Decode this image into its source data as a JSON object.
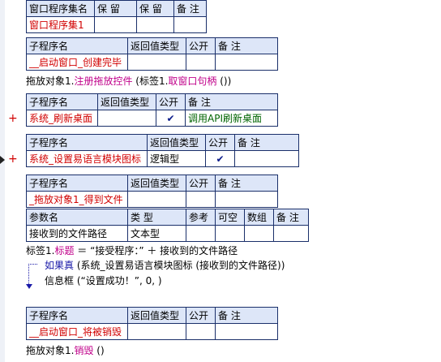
{
  "tbl_set": {
    "headers": [
      "窗口程序集名",
      "保 留",
      "保 留",
      "备 注"
    ],
    "row": [
      "窗口程序集1",
      "",
      "",
      ""
    ]
  },
  "sub_headers": [
    "子程序名",
    "返回值类型",
    "公开",
    "备 注"
  ],
  "param_headers": [
    "参数名",
    "类 型",
    "参考",
    "可空",
    "数组",
    "备 注"
  ],
  "sub1": {
    "name": "__启动窗口_创建完毕",
    "ret": "",
    "pub": "",
    "note": ""
  },
  "line1": {
    "a": "拖放对象1.",
    "b": "注册拖放控件",
    "c": " (标签1.",
    "d": "取窗口句柄",
    "e": " ())"
  },
  "sub2": {
    "name": "系统_刷新桌面",
    "ret": "",
    "pub": "✔",
    "note": "调用API刷新桌面"
  },
  "sub3": {
    "name": "系统_设置易语言模块图标",
    "ret": "逻辑型",
    "pub": "✔",
    "note": ""
  },
  "sub4": {
    "name": "_拖放对象1_得到文件",
    "ret": "",
    "pub": "",
    "note": ""
  },
  "param1": {
    "name": "接收到的文件路径",
    "type": "文本型",
    "ref": "",
    "nullable": "",
    "array": "",
    "note": ""
  },
  "line2": {
    "a": "标签1.",
    "b": "标题",
    "c": " ＝ “接受程序：” ＋ 接收到的文件路径"
  },
  "line3": {
    "a": "如果真",
    "b": " (系统_设置易语言模块图标 (接收到的文件路径))"
  },
  "line4": {
    "a": "信息框",
    "b": " (“设置成功！”, 0, )"
  },
  "sub5": {
    "name": "__启动窗口_将被销毁",
    "ret": "",
    "pub": "",
    "note": ""
  },
  "line5": {
    "a": "拖放对象1.",
    "b": "销毁",
    "c": " ()"
  },
  "icons": {
    "plus": "+",
    "check": "✔"
  }
}
